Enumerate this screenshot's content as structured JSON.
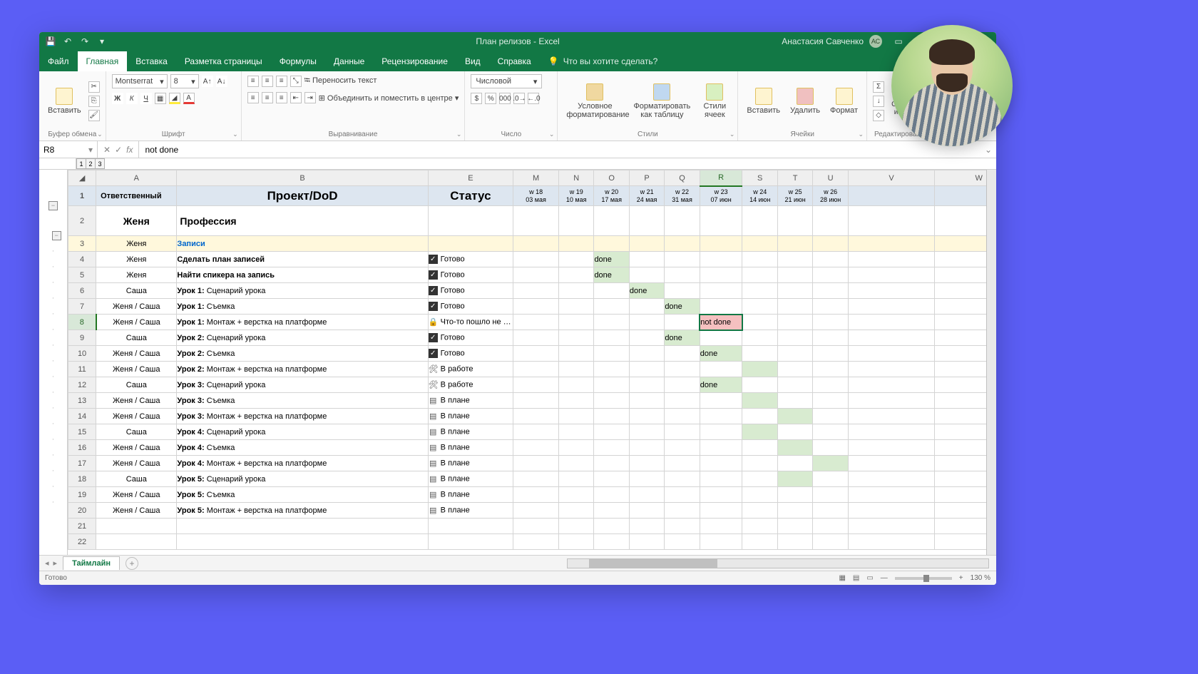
{
  "app": {
    "title": "План релизов  -  Excel",
    "user_name": "Анастасия Савченко",
    "user_initials": "АС"
  },
  "tabs": [
    "Файл",
    "Главная",
    "Вставка",
    "Разметка страницы",
    "Формулы",
    "Данные",
    "Рецензирование",
    "Вид",
    "Справка"
  ],
  "active_tab": "Главная",
  "tell_me": "Что вы хотите сделать?",
  "ribbon": {
    "clipboard": {
      "paste": "Вставить",
      "label": "Буфер обмена"
    },
    "font": {
      "name": "Montserrat",
      "size": "8",
      "label": "Шрифт"
    },
    "align": {
      "wrap": "Переносить текст",
      "merge": "Объединить и поместить в центре",
      "label": "Выравнивание"
    },
    "number": {
      "format": "Числовой",
      "label": "Число"
    },
    "styles": {
      "cond": "Условное форматирование",
      "table": "Форматировать как таблицу",
      "cell": "Стили ячеек",
      "label": "Стили"
    },
    "cells": {
      "insert": "Вставить",
      "delete": "Удалить",
      "format": "Формат",
      "label": "Ячейки"
    },
    "editing": {
      "sort": "Сортировка и фильтр",
      "label": "Редактирование"
    }
  },
  "name_box": "R8",
  "formula": "not done",
  "outline_levels": [
    "1",
    "2",
    "3"
  ],
  "col_letters": [
    "A",
    "B",
    "E",
    "M",
    "N",
    "O",
    "P",
    "Q",
    "R",
    "S",
    "T",
    "U",
    "V",
    "W"
  ],
  "selected_col_idx": 8,
  "header_row": {
    "a": "Ответственный",
    "b": "Проект/DoD",
    "e": "Статус",
    "weeks": [
      {
        "w": "w 18",
        "d": "03  мая"
      },
      {
        "w": "w 19",
        "d": "10  мая"
      },
      {
        "w": "w 20",
        "d": "17  мая"
      },
      {
        "w": "w 21",
        "d": "24  мая"
      },
      {
        "w": "w 22",
        "d": "31  мая"
      },
      {
        "w": "w 23",
        "d": "07  июн"
      },
      {
        "w": "w 24",
        "d": "14  июн"
      },
      {
        "w": "w 25",
        "d": "21  июн"
      },
      {
        "w": "w 26",
        "d": "28  июн"
      }
    ]
  },
  "section": {
    "owner": "Женя",
    "title": "Профессия"
  },
  "rows": [
    {
      "n": 3,
      "owner": "Женя",
      "task_bold": "",
      "task": "Записи",
      "status": "",
      "status_type": "link",
      "gantt": null
    },
    {
      "n": 4,
      "owner": "Женя",
      "task_bold": "Сделать план записей",
      "task": "",
      "status": "Готово",
      "status_type": "done",
      "gantt": {
        "col": 2,
        "text": "done"
      }
    },
    {
      "n": 5,
      "owner": "Женя",
      "task_bold": "Найти спикера на запись",
      "task": "",
      "status": "Готово",
      "status_type": "done",
      "gantt": {
        "col": 2,
        "text": "done"
      }
    },
    {
      "n": 6,
      "owner": "Саша",
      "task_bold": "Урок 1:",
      "task": " Сценарий урока",
      "status": "Готово",
      "status_type": "done",
      "gantt": {
        "col": 3,
        "text": "done"
      }
    },
    {
      "n": 7,
      "owner": "Женя / Саша",
      "task_bold": "Урок 1:",
      "task": " Съемка",
      "status": "Готово",
      "status_type": "done",
      "gantt": {
        "col": 4,
        "text": "done"
      }
    },
    {
      "n": 8,
      "owner": "Женя / Саша",
      "task_bold": "Урок 1:",
      "task": " Монтаж + верстка на платформе",
      "status": "Что-то пошло не так",
      "status_type": "warn",
      "gantt": {
        "col": 5,
        "text": "not done",
        "bad": true
      }
    },
    {
      "n": 9,
      "owner": "Саша",
      "task_bold": "Урок 2:",
      "task": " Сценарий урока",
      "status": "Готово",
      "status_type": "done",
      "gantt": {
        "col": 4,
        "text": "done"
      }
    },
    {
      "n": 10,
      "owner": "Женя / Саша",
      "task_bold": "Урок 2:",
      "task": " Съемка",
      "status": "Готово",
      "status_type": "done",
      "gantt": {
        "col": 5,
        "text": "done"
      }
    },
    {
      "n": 11,
      "owner": "Женя / Саша",
      "task_bold": "Урок 2:",
      "task": " Монтаж + верстка на платформе",
      "status": "В работе",
      "status_type": "work",
      "gantt": {
        "col": 6,
        "text": ""
      }
    },
    {
      "n": 12,
      "owner": "Саша",
      "task_bold": "Урок 3:",
      "task": " Сценарий урока",
      "status": "В работе",
      "status_type": "work",
      "gantt": {
        "col": 5,
        "text": "done"
      }
    },
    {
      "n": 13,
      "owner": "Женя / Саша",
      "task_bold": "Урок 3:",
      "task": " Съемка",
      "status": "В плане",
      "status_type": "plan",
      "gantt": {
        "col": 6,
        "text": ""
      }
    },
    {
      "n": 14,
      "owner": "Женя / Саша",
      "task_bold": "Урок 3:",
      "task": " Монтаж + верстка на платформе",
      "status": "В плане",
      "status_type": "plan",
      "gantt": {
        "col": 7,
        "text": ""
      }
    },
    {
      "n": 15,
      "owner": "Саша",
      "task_bold": "Урок 4:",
      "task": " Сценарий урока",
      "status": "В плане",
      "status_type": "plan",
      "gantt": {
        "col": 6,
        "text": ""
      }
    },
    {
      "n": 16,
      "owner": "Женя / Саша",
      "task_bold": "Урок 4:",
      "task": " Съемка",
      "status": "В плане",
      "status_type": "plan",
      "gantt": {
        "col": 7,
        "text": ""
      }
    },
    {
      "n": 17,
      "owner": "Женя / Саша",
      "task_bold": "Урок 4:",
      "task": " Монтаж + верстка на платформе",
      "status": "В плане",
      "status_type": "plan",
      "gantt": {
        "col": 8,
        "text": ""
      }
    },
    {
      "n": 18,
      "owner": "Саша",
      "task_bold": "Урок 5:",
      "task": " Сценарий урока",
      "status": "В плане",
      "status_type": "plan",
      "gantt": {
        "col": 7,
        "text": ""
      }
    },
    {
      "n": 19,
      "owner": "Женя / Саша",
      "task_bold": "Урок 5:",
      "task": " Съемка",
      "status": "В плане",
      "status_type": "plan",
      "gantt": null
    },
    {
      "n": 20,
      "owner": "Женя / Саша",
      "task_bold": "Урок 5:",
      "task": " Монтаж + верстка на платформе",
      "status": "В плане",
      "status_type": "plan",
      "gantt": null
    }
  ],
  "empty_rows": [
    21,
    22
  ],
  "sheet_tab": "Таймлайн",
  "status_ready": "Готово",
  "zoom": "130 %"
}
